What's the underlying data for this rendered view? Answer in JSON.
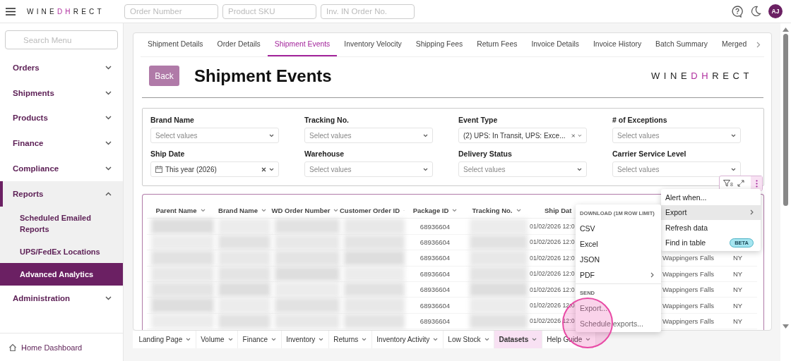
{
  "header": {
    "logo": [
      "WINE",
      "DH",
      "RECT"
    ],
    "search_fields": [
      {
        "placeholder": "Order Number"
      },
      {
        "placeholder": "Product SKU"
      },
      {
        "placeholder": "Inv. IN Order No."
      }
    ],
    "avatar": "AJ"
  },
  "sidebar": {
    "search": {
      "placeholder": "Search Menu"
    },
    "items": [
      {
        "label": "Orders",
        "expanded": false
      },
      {
        "label": "Shipments",
        "expanded": false
      },
      {
        "label": "Products",
        "expanded": false
      },
      {
        "label": "Finance",
        "expanded": false
      },
      {
        "label": "Compliance",
        "expanded": false
      },
      {
        "label": "Reports",
        "expanded": true,
        "children": [
          {
            "label": "Scheduled Emailed Reports",
            "selected": false
          },
          {
            "label": "UPS/FedEx Locations",
            "selected": false
          },
          {
            "label": "Advanced Analytics",
            "selected": true
          }
        ]
      },
      {
        "label": "Administration",
        "expanded": false
      }
    ],
    "footer": "Home Dashboard"
  },
  "tabs": [
    {
      "label": "Shipment Details",
      "selected": false
    },
    {
      "label": "Order Details",
      "selected": false
    },
    {
      "label": "Shipment Events",
      "selected": true
    },
    {
      "label": "Inventory Velocity",
      "selected": false
    },
    {
      "label": "Shipping Fees",
      "selected": false
    },
    {
      "label": "Return Fees",
      "selected": false
    },
    {
      "label": "Invoice Details",
      "selected": false
    },
    {
      "label": "Invoice History",
      "selected": false
    },
    {
      "label": "Batch Summary",
      "selected": false
    },
    {
      "label": "Merged",
      "selected": false
    }
  ],
  "page": {
    "back_button": "Back",
    "title": "Shipment Events",
    "logo": [
      "WINE",
      "DH",
      "RECT"
    ]
  },
  "filters": [
    {
      "label": "Brand Name",
      "kind": "select",
      "placeholder": "Select values",
      "clearable": false
    },
    {
      "label": "Tracking No.",
      "kind": "select",
      "placeholder": "Select values",
      "clearable": false
    },
    {
      "label": "Event Type",
      "kind": "select",
      "value": "(2) UPS: In Transit, UPS: Exce...",
      "clearable": true
    },
    {
      "label": "# of Exceptions",
      "kind": "select",
      "placeholder": "Select values",
      "clearable": false
    },
    {
      "label": "Ship Date",
      "kind": "date",
      "value": "This year (2026)",
      "clearable": true
    },
    {
      "label": "Warehouse",
      "kind": "select",
      "placeholder": "Select values",
      "clearable": false
    },
    {
      "label": "Delivery Status",
      "kind": "select",
      "placeholder": "Select values",
      "clearable": false
    },
    {
      "label": "Carrier Service Level",
      "kind": "select",
      "placeholder": "Select values",
      "clearable": false
    }
  ],
  "table": {
    "filter_count": "8",
    "columns": [
      "Parent Name",
      "Brand Name",
      "WD Order Number",
      "Customer Order ID",
      "Package ID",
      "Tracking No.",
      "Ship Dat"
    ],
    "rows": [
      {
        "package_id": "68936604",
        "ship_date": "01/02/2026 12:0"
      },
      {
        "package_id": "68936604",
        "ship_date": "01/02/2026 12:0"
      },
      {
        "package_id": "68936604",
        "ship_date": "01/02/2026 12:0",
        "column_8": "Wappingers Falls",
        "column_9": "NY"
      },
      {
        "package_id": "68936604",
        "ship_date": "01/02/2026 12:0",
        "column_8": "Wappingers Falls",
        "column_9": "NY"
      },
      {
        "package_id": "68936604",
        "ship_date": "01/02/2026 12:0",
        "column_8": "Wappingers Falls",
        "column_9": "NY"
      },
      {
        "package_id": "68936604",
        "ship_date": "01/02/2026 12:0",
        "column_8": "Wappingers Falls",
        "column_9": "NY"
      },
      {
        "package_id": "68936604",
        "ship_date": "01/02/2026 12:0",
        "column_8": "Wappingers Falls",
        "column_9": "NY"
      }
    ]
  },
  "menu": [
    {
      "label": "Alert when...",
      "submenu": false,
      "selected": false
    },
    {
      "label": "Export",
      "submenu": true,
      "selected": true
    },
    {
      "label": "Refresh data",
      "submenu": false,
      "selected": false
    },
    {
      "label": "Find in table",
      "submenu": false,
      "selected": false,
      "badge": "BETA"
    }
  ],
  "export_menu": [
    {
      "header": "DOWNLOAD (1M ROW LIMIT)",
      "items": [
        {
          "label": "CSV",
          "submenu": false
        },
        {
          "label": "Excel",
          "submenu": false
        },
        {
          "label": "JSON",
          "submenu": false
        },
        {
          "label": "PDF",
          "submenu": true
        }
      ]
    },
    {
      "header": "SEND",
      "items": [
        {
          "label": "Export...",
          "submenu": false
        },
        {
          "label": "Schedule exports...",
          "submenu": false
        }
      ]
    }
  ],
  "bottom_tabs": [
    {
      "label": "Landing Page",
      "selected": false
    },
    {
      "label": "Volume",
      "selected": false
    },
    {
      "label": "Finance",
      "selected": false
    },
    {
      "label": "Inventory",
      "selected": false
    },
    {
      "label": "Returns",
      "selected": false
    },
    {
      "label": "Inventory Activity",
      "selected": false
    },
    {
      "label": "Low Stock",
      "selected": false
    },
    {
      "label": "Datasets",
      "selected": true
    },
    {
      "label": "Help Guide",
      "selected": false
    }
  ]
}
